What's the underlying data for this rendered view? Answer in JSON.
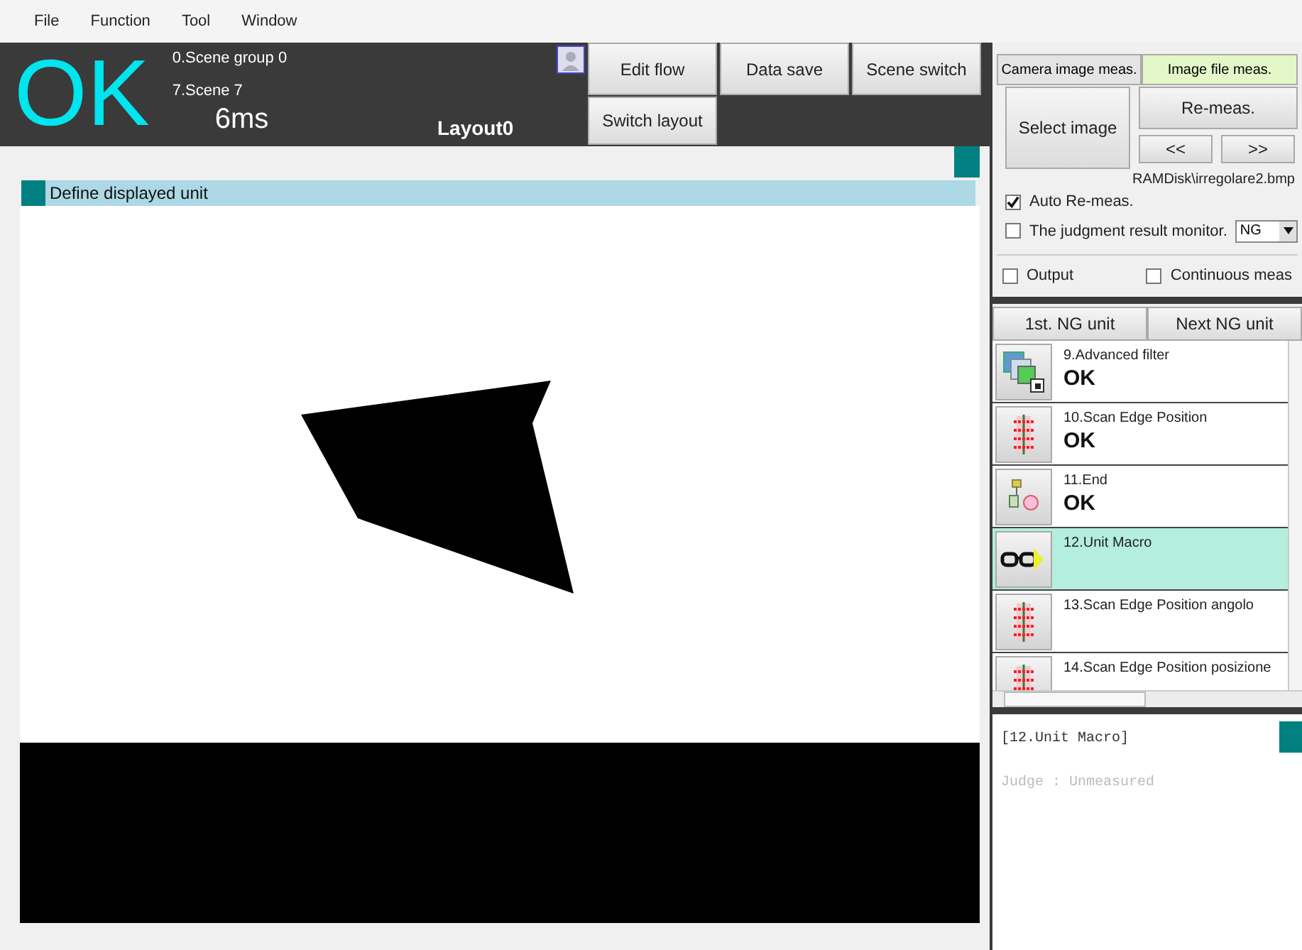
{
  "menu": [
    "File",
    "Function",
    "Tool",
    "Window"
  ],
  "header": {
    "judgement": "OK",
    "scene_group": "0.Scene group 0",
    "scene": "7.Scene 7",
    "time": "6ms",
    "layout": "Layout0"
  },
  "toolbar_buttons": [
    "Edit flow",
    "Data save",
    "Scene switch",
    "Switch layout"
  ],
  "viewer": {
    "unit_label": "Define displayed unit"
  },
  "measure": {
    "tabs": [
      {
        "label": "Camera image meas.",
        "selected": false
      },
      {
        "label": "Image file meas.",
        "selected": true
      }
    ],
    "select_image": "Select image",
    "remeas": "Re-meas.",
    "prev": "<<",
    "next": ">>",
    "file": "RAMDisk\\irregolare2.bmp",
    "checkboxes": [
      {
        "label": "Auto Re-meas.",
        "checked": true
      },
      {
        "label": "The judgment result monitor.",
        "checked": false
      }
    ],
    "monitor_select": "NG",
    "output_checkboxes": [
      {
        "label": "Output",
        "checked": false
      },
      {
        "label": "Continuous meas",
        "checked": false
      }
    ]
  },
  "nav_buttons": [
    "1st. NG unit",
    "Next NG unit"
  ],
  "units": [
    {
      "name": "9.Advanced filter",
      "result": "OK",
      "kind": "filter",
      "selected": false
    },
    {
      "name": "10.Scan Edge Position",
      "result": "OK",
      "kind": "scan",
      "selected": false
    },
    {
      "name": "11.End",
      "result": "OK",
      "kind": "end",
      "selected": false
    },
    {
      "name": "12.Unit Macro",
      "kind": "macro",
      "selected": true
    },
    {
      "name": "13.Scan Edge Position angolo",
      "kind": "scan",
      "selected": false
    },
    {
      "name": "14.Scan Edge Position posizione",
      "kind": "scan",
      "selected": false
    }
  ],
  "detail": {
    "title": "[12.Unit Macro]",
    "judge": "Judge : Unmeasured"
  }
}
